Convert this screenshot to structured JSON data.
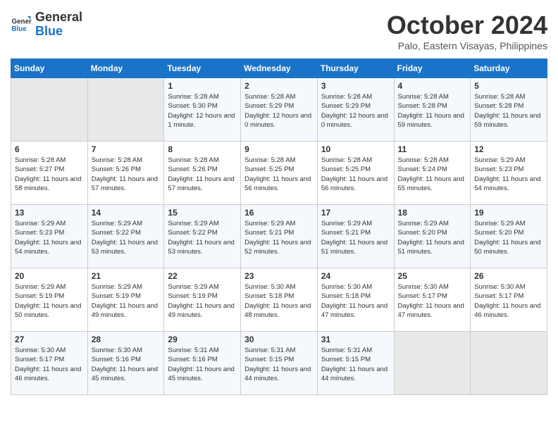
{
  "header": {
    "logo_line1": "General",
    "logo_line2": "Blue",
    "month": "October 2024",
    "location": "Palo, Eastern Visayas, Philippines"
  },
  "weekdays": [
    "Sunday",
    "Monday",
    "Tuesday",
    "Wednesday",
    "Thursday",
    "Friday",
    "Saturday"
  ],
  "weeks": [
    [
      {
        "day": "",
        "empty": true
      },
      {
        "day": "",
        "empty": true
      },
      {
        "day": "1",
        "sunrise": "5:28 AM",
        "sunset": "5:30 PM",
        "daylight": "12 hours and 1 minute."
      },
      {
        "day": "2",
        "sunrise": "5:28 AM",
        "sunset": "5:29 PM",
        "daylight": "12 hours and 0 minutes."
      },
      {
        "day": "3",
        "sunrise": "5:28 AM",
        "sunset": "5:29 PM",
        "daylight": "12 hours and 0 minutes."
      },
      {
        "day": "4",
        "sunrise": "5:28 AM",
        "sunset": "5:28 PM",
        "daylight": "11 hours and 59 minutes."
      },
      {
        "day": "5",
        "sunrise": "5:28 AM",
        "sunset": "5:28 PM",
        "daylight": "11 hours and 59 minutes."
      }
    ],
    [
      {
        "day": "6",
        "sunrise": "5:28 AM",
        "sunset": "5:27 PM",
        "daylight": "11 hours and 58 minutes."
      },
      {
        "day": "7",
        "sunrise": "5:28 AM",
        "sunset": "5:26 PM",
        "daylight": "11 hours and 57 minutes."
      },
      {
        "day": "8",
        "sunrise": "5:28 AM",
        "sunset": "5:26 PM",
        "daylight": "11 hours and 57 minutes."
      },
      {
        "day": "9",
        "sunrise": "5:28 AM",
        "sunset": "5:25 PM",
        "daylight": "11 hours and 56 minutes."
      },
      {
        "day": "10",
        "sunrise": "5:28 AM",
        "sunset": "5:25 PM",
        "daylight": "11 hours and 56 minutes."
      },
      {
        "day": "11",
        "sunrise": "5:28 AM",
        "sunset": "5:24 PM",
        "daylight": "11 hours and 55 minutes."
      },
      {
        "day": "12",
        "sunrise": "5:29 AM",
        "sunset": "5:23 PM",
        "daylight": "11 hours and 54 minutes."
      }
    ],
    [
      {
        "day": "13",
        "sunrise": "5:29 AM",
        "sunset": "5:23 PM",
        "daylight": "11 hours and 54 minutes."
      },
      {
        "day": "14",
        "sunrise": "5:29 AM",
        "sunset": "5:22 PM",
        "daylight": "11 hours and 53 minutes."
      },
      {
        "day": "15",
        "sunrise": "5:29 AM",
        "sunset": "5:22 PM",
        "daylight": "11 hours and 53 minutes."
      },
      {
        "day": "16",
        "sunrise": "5:29 AM",
        "sunset": "5:21 PM",
        "daylight": "11 hours and 52 minutes."
      },
      {
        "day": "17",
        "sunrise": "5:29 AM",
        "sunset": "5:21 PM",
        "daylight": "11 hours and 51 minutes."
      },
      {
        "day": "18",
        "sunrise": "5:29 AM",
        "sunset": "5:20 PM",
        "daylight": "11 hours and 51 minutes."
      },
      {
        "day": "19",
        "sunrise": "5:29 AM",
        "sunset": "5:20 PM",
        "daylight": "11 hours and 50 minutes."
      }
    ],
    [
      {
        "day": "20",
        "sunrise": "5:29 AM",
        "sunset": "5:19 PM",
        "daylight": "11 hours and 50 minutes."
      },
      {
        "day": "21",
        "sunrise": "5:29 AM",
        "sunset": "5:19 PM",
        "daylight": "11 hours and 49 minutes."
      },
      {
        "day": "22",
        "sunrise": "5:29 AM",
        "sunset": "5:19 PM",
        "daylight": "11 hours and 49 minutes."
      },
      {
        "day": "23",
        "sunrise": "5:30 AM",
        "sunset": "5:18 PM",
        "daylight": "11 hours and 48 minutes."
      },
      {
        "day": "24",
        "sunrise": "5:30 AM",
        "sunset": "5:18 PM",
        "daylight": "11 hours and 47 minutes."
      },
      {
        "day": "25",
        "sunrise": "5:30 AM",
        "sunset": "5:17 PM",
        "daylight": "11 hours and 47 minutes."
      },
      {
        "day": "26",
        "sunrise": "5:30 AM",
        "sunset": "5:17 PM",
        "daylight": "11 hours and 46 minutes."
      }
    ],
    [
      {
        "day": "27",
        "sunrise": "5:30 AM",
        "sunset": "5:17 PM",
        "daylight": "11 hours and 46 minutes."
      },
      {
        "day": "28",
        "sunrise": "5:30 AM",
        "sunset": "5:16 PM",
        "daylight": "11 hours and 45 minutes."
      },
      {
        "day": "29",
        "sunrise": "5:31 AM",
        "sunset": "5:16 PM",
        "daylight": "11 hours and 45 minutes."
      },
      {
        "day": "30",
        "sunrise": "5:31 AM",
        "sunset": "5:15 PM",
        "daylight": "11 hours and 44 minutes."
      },
      {
        "day": "31",
        "sunrise": "5:31 AM",
        "sunset": "5:15 PM",
        "daylight": "11 hours and 44 minutes."
      },
      {
        "day": "",
        "empty": true
      },
      {
        "day": "",
        "empty": true
      }
    ]
  ],
  "labels": {
    "sunrise": "Sunrise:",
    "sunset": "Sunset:",
    "daylight": "Daylight:"
  }
}
